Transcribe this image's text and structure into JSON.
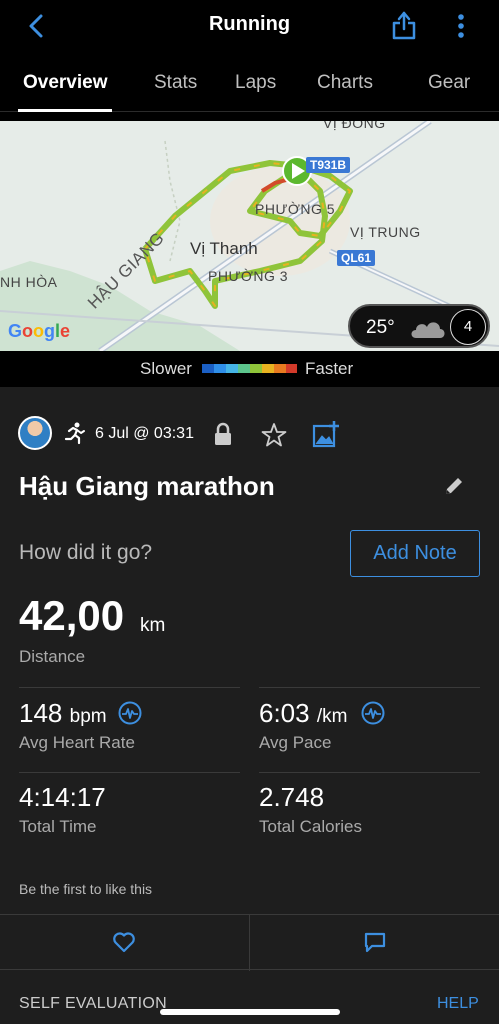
{
  "header": {
    "title": "Running"
  },
  "tabs": [
    {
      "label": "Overview"
    },
    {
      "label": "Stats"
    },
    {
      "label": "Laps"
    },
    {
      "label": "Charts"
    },
    {
      "label": "Gear"
    }
  ],
  "map": {
    "labels": {
      "vi_dong": "VỊ ĐÔNG",
      "phuong5": "PHƯỜNG 5",
      "vi_thanh": "Vị Thanh",
      "vi_trung": "VỊ TRUNG",
      "phuong3": "PHƯỜNG 3",
      "hau_giang": "HẬU GIANG",
      "nh_hoa": "NH HÒA"
    },
    "badges": {
      "t931b": "T931B",
      "ql61": "QL61"
    },
    "google": "Google",
    "weather": {
      "temp": "25°",
      "compass": "4"
    }
  },
  "legend": {
    "slower": "Slower",
    "faster": "Faster"
  },
  "activity": {
    "date": "6 Jul @ 03:31",
    "title": "Hậu Giang marathon",
    "prompt": "How did it go?",
    "add_note": "Add Note",
    "distance": {
      "value": "42,00",
      "unit": "km",
      "label": "Distance"
    },
    "heart_rate": {
      "value": "148",
      "unit": "bpm",
      "label": "Avg Heart Rate"
    },
    "pace": {
      "value": "6:03",
      "unit": "/km",
      "label": "Avg Pace"
    },
    "time": {
      "value": "4:14:17",
      "label": "Total Time"
    },
    "calories": {
      "value": "2.748",
      "label": "Total Calories"
    },
    "like_text": "Be the first to like this"
  },
  "footer": {
    "self_eval": "SELF EVALUATION",
    "help": "HELP"
  },
  "colors": {
    "accent": "#3d8fe0",
    "background": "#1e1e1e"
  }
}
